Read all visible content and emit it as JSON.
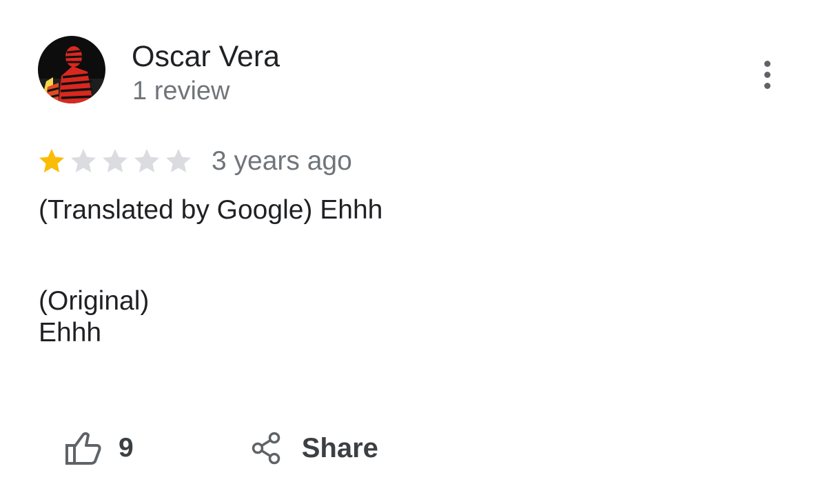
{
  "author": {
    "name": "Oscar Vera",
    "meta": "1 review"
  },
  "rating": {
    "stars": 1,
    "max": 5,
    "filled_color": "#fbbc04",
    "empty_color": "#dadce0"
  },
  "review": {
    "date": "3 years ago",
    "translated_text": "(Translated by Google) Ehhh",
    "original_heading": "(Original)",
    "original_text": "Ehhh"
  },
  "actions": {
    "like_icon": "thumbs-up-icon",
    "like_count": "9",
    "share_icon": "share-icon",
    "share_label": "Share",
    "more_icon": "more-vert-icon"
  }
}
